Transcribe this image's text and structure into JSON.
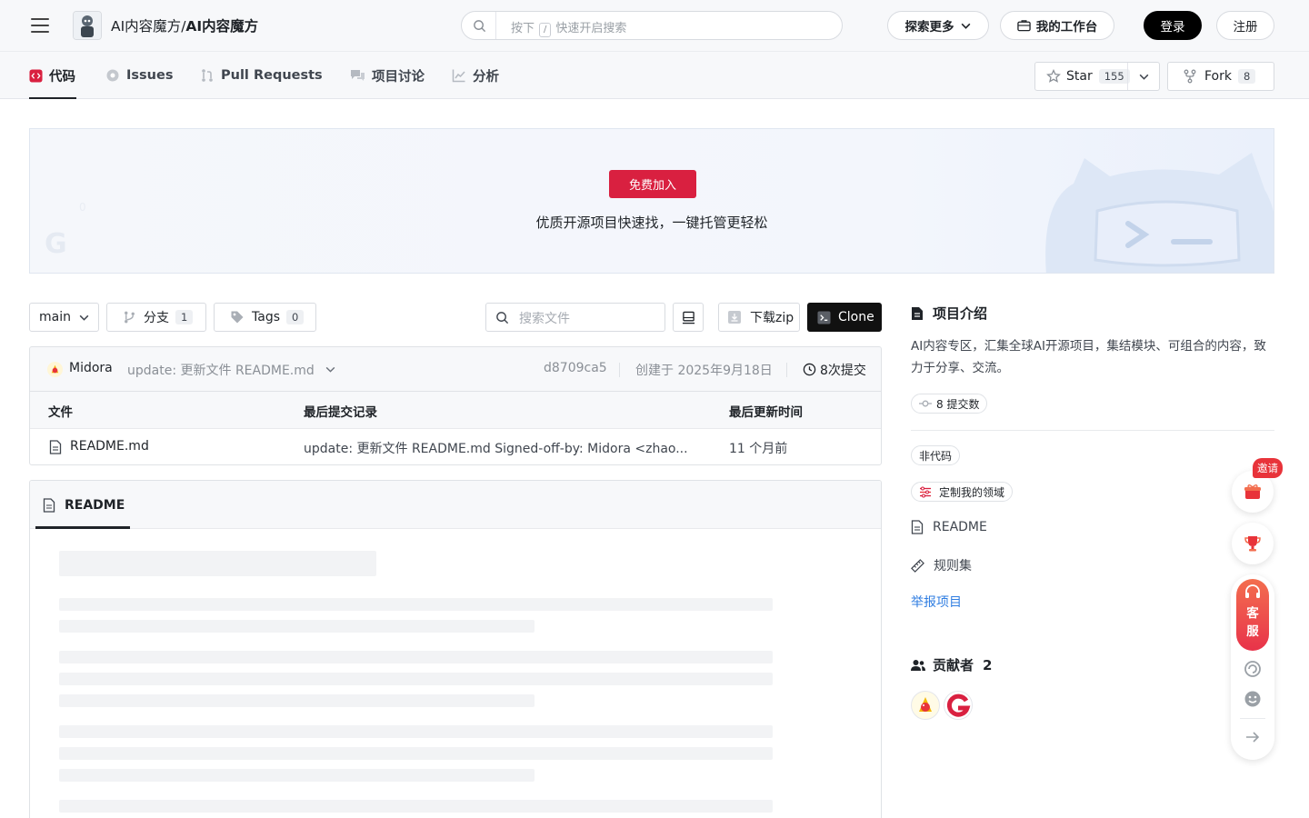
{
  "header": {
    "repo_owner": "AI内容魔方",
    "separator": "/",
    "repo_name": "AI内容魔方",
    "search_prefix": "按下",
    "search_key": "/",
    "search_placeholder": "快速开启搜索",
    "explore_label": "探索更多",
    "workbench_label": "我的工作台",
    "login_label": "登录",
    "register_label": "注册"
  },
  "tabs": [
    {
      "label": "代码",
      "icon": "code-icon"
    },
    {
      "label": "Issues",
      "icon": "issue-icon"
    },
    {
      "label": "Pull Requests",
      "icon": "pull-request-icon"
    },
    {
      "label": "项目讨论",
      "icon": "discussion-icon"
    },
    {
      "label": "分析",
      "icon": "chart-icon"
    }
  ],
  "repo_actions": {
    "star_label": "Star",
    "star_count": "155",
    "fork_label": "Fork",
    "fork_count": "8"
  },
  "banner": {
    "join_label": "免费加入",
    "tagline": "优质开源项目快速找，一键托管更轻松"
  },
  "toolbar": {
    "branch": "main",
    "branches_label": "分支",
    "branches_count": "1",
    "tags_label": "Tags",
    "tags_count": "0",
    "file_search_placeholder": "搜索文件",
    "download_label": "下载zip",
    "clone_label": "Clone"
  },
  "commit": {
    "author": "Midora",
    "message": "update: 更新文件 README.md",
    "hash": "d8709ca5",
    "created": "创建于 2025年9月18日",
    "commits": "8次提交"
  },
  "file_table": {
    "headers": [
      "文件",
      "最后提交记录",
      "最后更新时间"
    ],
    "rows": [
      {
        "name": "README.md",
        "message": "update: 更新文件 README.md Signed-off-by: Midora <zhao...",
        "time": "11 个月前"
      }
    ]
  },
  "readme": {
    "tab_label": "README"
  },
  "sidebar": {
    "intro_title": "项目介绍",
    "description": "AI内容专区，汇集全球AI开源项目，集结模块、可组合的内容，致力于分享、交流。",
    "commits_chip": "8 提交数",
    "noncode_chip": "非代码",
    "domain_chip": "定制我的领域",
    "readme_link": "README",
    "rules_link": "规则集",
    "report_link": "举报项目",
    "contributors_title": "贡献者",
    "contributors_count": "2"
  },
  "floating": {
    "invite_badge": "邀请",
    "cs_line1": "客",
    "cs_line2": "服"
  },
  "colors": {
    "brand_red": "#d92040",
    "link_blue": "#2f7de1",
    "cs_gradient_start": "#f36e4f",
    "cs_gradient_end": "#e8334a"
  }
}
